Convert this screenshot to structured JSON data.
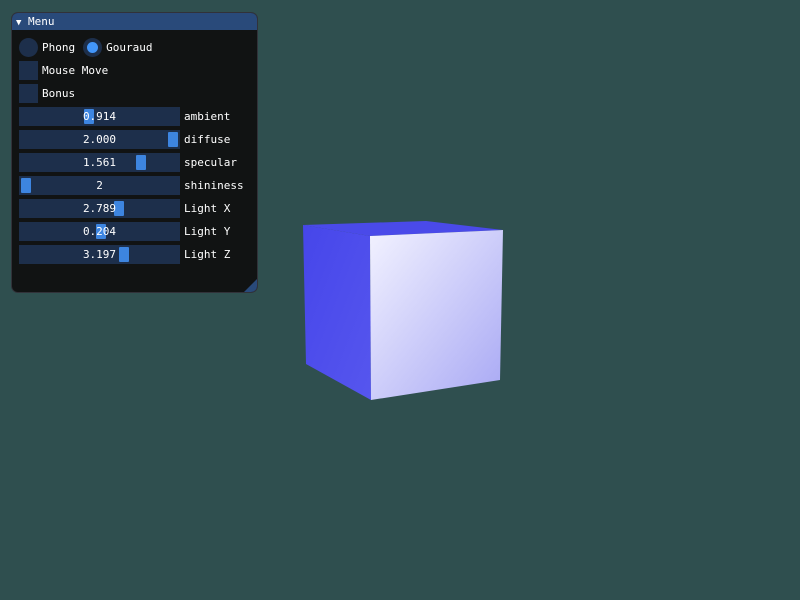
{
  "window": {
    "title": "Menu",
    "collapse_glyph": "▼"
  },
  "shading": {
    "options": [
      {
        "label": "Phong",
        "selected": false
      },
      {
        "label": "Gouraud",
        "selected": true
      }
    ]
  },
  "checkboxes": [
    {
      "label": "Mouse Move",
      "checked": false
    },
    {
      "label": "Bonus",
      "checked": false
    }
  ],
  "sliders": [
    {
      "label": "ambient",
      "value": "0.914",
      "fraction": 0.43
    },
    {
      "label": "diffuse",
      "value": "2.000",
      "fraction": 1.0
    },
    {
      "label": "specular",
      "value": "1.561",
      "fraction": 0.78
    },
    {
      "label": "shininess",
      "value": "2",
      "fraction": 0.0
    },
    {
      "label": "Light X",
      "value": "2.789",
      "fraction": 0.63
    },
    {
      "label": "Light Y",
      "value": "0.204",
      "fraction": 0.51
    },
    {
      "label": "Light Z",
      "value": "3.197",
      "fraction": 0.67
    }
  ],
  "colors": {
    "background": "#2f4f4f",
    "accent": "#4296fa",
    "cube_dark_face": "#4848e8",
    "cube_light_face": "#ececff"
  }
}
